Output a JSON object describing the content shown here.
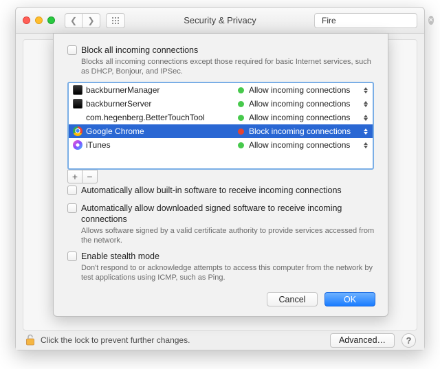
{
  "window": {
    "title": "Security & Privacy",
    "search_value": "Fire"
  },
  "sheet": {
    "block_all": {
      "label": "Block all incoming connections",
      "help": "Blocks all incoming connections except those required for basic Internet services,  such as DHCP, Bonjour, and IPSec."
    },
    "apps": [
      {
        "icon": "exec",
        "name": "backburnerManager",
        "state_color": "green",
        "state_label": "Allow incoming connections",
        "selected": false
      },
      {
        "icon": "exec",
        "name": "backburnerServer",
        "state_color": "green",
        "state_label": "Allow incoming connections",
        "selected": false
      },
      {
        "icon": "none",
        "name": "com.hegenberg.BetterTouchTool",
        "state_color": "green",
        "state_label": "Allow incoming connections",
        "selected": false
      },
      {
        "icon": "chrome",
        "name": "Google Chrome",
        "state_color": "red",
        "state_label": "Block incoming connections",
        "selected": true
      },
      {
        "icon": "itunes",
        "name": "iTunes",
        "state_color": "green",
        "state_label": "Allow incoming connections",
        "selected": false
      }
    ],
    "auto_builtin": {
      "label": "Automatically allow built-in software to receive incoming connections"
    },
    "auto_signed": {
      "label": "Automatically allow downloaded signed software to receive incoming connections",
      "help": "Allows software signed by a valid certificate authority to provide services accessed from the network."
    },
    "stealth": {
      "label": "Enable stealth mode",
      "help": "Don't respond to or acknowledge attempts to access this computer from the network by test applications using ICMP, such as Ping."
    },
    "cancel_label": "Cancel",
    "ok_label": "OK"
  },
  "footer": {
    "lock_text": "Click the lock to prevent further changes.",
    "advanced_label": "Advanced…"
  }
}
